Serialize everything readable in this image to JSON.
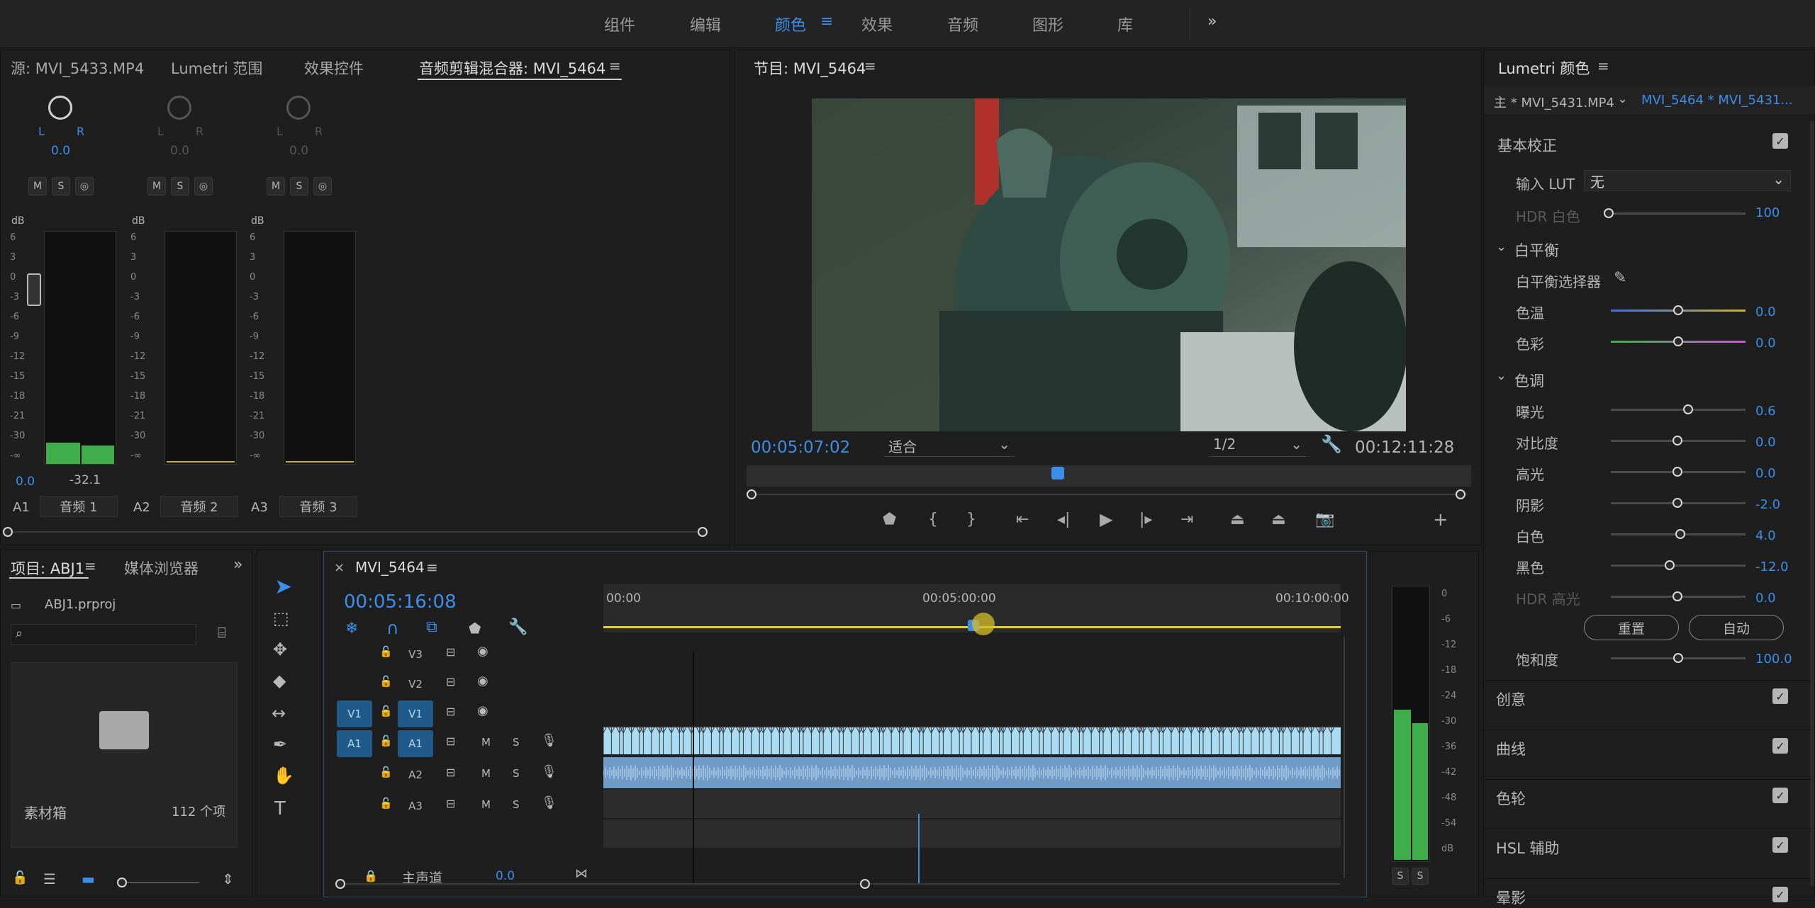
{
  "workspaces": [
    "组件",
    "编辑",
    "颜色",
    "效果",
    "音频",
    "图形",
    "库"
  ],
  "workspace_more": "»",
  "top_left_tabs": {
    "source": "源: MVI_5433.MP4",
    "scopes": "Lumetri 范围",
    "effects": "效果控件",
    "mixer": "音频剪辑混合器: MVI_5464"
  },
  "mixer": {
    "channels": [
      {
        "id": "A1",
        "name": "音频 1",
        "pan_l": "L",
        "pan_r": "R",
        "pan": "0.0",
        "peak_left": "0.0",
        "peak_right": "-32.1",
        "level": 0.12
      },
      {
        "id": "A2",
        "name": "音频 2",
        "pan_l": "L",
        "pan_r": "R",
        "pan": "0.0",
        "level": 0
      },
      {
        "id": "A3",
        "name": "音频 3",
        "pan_l": "L",
        "pan_r": "R",
        "pan": "0.0",
        "level": 0
      }
    ],
    "msr": [
      "M",
      "S",
      "◎"
    ],
    "db_label": "dB",
    "scale": [
      "6",
      "3",
      "0",
      "-3",
      "-6",
      "-9",
      "-12",
      "-15",
      "-18",
      "-21",
      "-30",
      "-∞"
    ]
  },
  "program": {
    "title": "节目: MVI_5464",
    "timecode": "00:05:07:02",
    "fit": "适合",
    "quality": "1/2",
    "duration": "00:12:11:28",
    "playhead": 0.43
  },
  "lumetri": {
    "title": "Lumetri 颜色",
    "clip_master": "主 * MVI_5431.MP4",
    "clip_seq": "MVI_5464 * MVI_5431...",
    "basic": "基本校正",
    "input_lut_label": "输入 LUT",
    "input_lut_value": "无",
    "hdr_white_label": "HDR 白色",
    "hdr_white_value": "100",
    "wb_section": "白平衡",
    "wb_picker": "白平衡选择器",
    "temp_label": "色温",
    "temp_value": "0.0",
    "tint_label": "色彩",
    "tint_value": "0.0",
    "tone_section": "色调",
    "exposure_label": "曝光",
    "exposure_value": "0.6",
    "contrast_label": "对比度",
    "contrast_value": "0.0",
    "highlights_label": "高光",
    "highlights_value": "0.0",
    "shadows_label": "阴影",
    "shadows_value": "-2.0",
    "whites_label": "白色",
    "whites_value": "4.0",
    "blacks_label": "黑色",
    "blacks_value": "-12.0",
    "hdr_spec_label": "HDR 高光",
    "hdr_spec_value": "0.0",
    "reset": "重置",
    "auto": "自动",
    "saturation_label": "饱和度",
    "saturation_value": "100.0",
    "sections": [
      "创意",
      "曲线",
      "色轮",
      "HSL 辅助",
      "晕影"
    ]
  },
  "project": {
    "tab_project": "项目: ABJ1",
    "tab_media": "媒体浏览器",
    "file": "ABJ1.prproj",
    "bin_label": "素材箱",
    "item_count": "112 个项"
  },
  "timeline": {
    "title": "MVI_5464",
    "timecode": "00:05:16:08",
    "ruler": [
      "00:00",
      "00:05:00:00",
      "00:10:00:00"
    ],
    "tracks": [
      {
        "id": "V3",
        "type": "video"
      },
      {
        "id": "V2",
        "type": "video"
      },
      {
        "id": "V1",
        "type": "video",
        "src": "V1"
      },
      {
        "id": "A1",
        "type": "audio",
        "src": "A1"
      },
      {
        "id": "A2",
        "type": "audio"
      },
      {
        "id": "A3",
        "type": "audio"
      }
    ],
    "master_label": "主声道",
    "master_value": "0.0",
    "m": "M",
    "s": "S"
  },
  "audio_meter": {
    "scale": [
      "0",
      "-6",
      "-12",
      "-18",
      "-24",
      "-30",
      "-36",
      "-42",
      "-48",
      "-54",
      "dB"
    ],
    "solo": [
      "S",
      "S"
    ],
    "left": 0.55,
    "right": 0.5
  },
  "colors": {
    "accent": "#3d8ee8",
    "clip_video": "#a9dcf2",
    "clip_audio": "#6f9bc9",
    "meter_green": "#3fae4a"
  }
}
